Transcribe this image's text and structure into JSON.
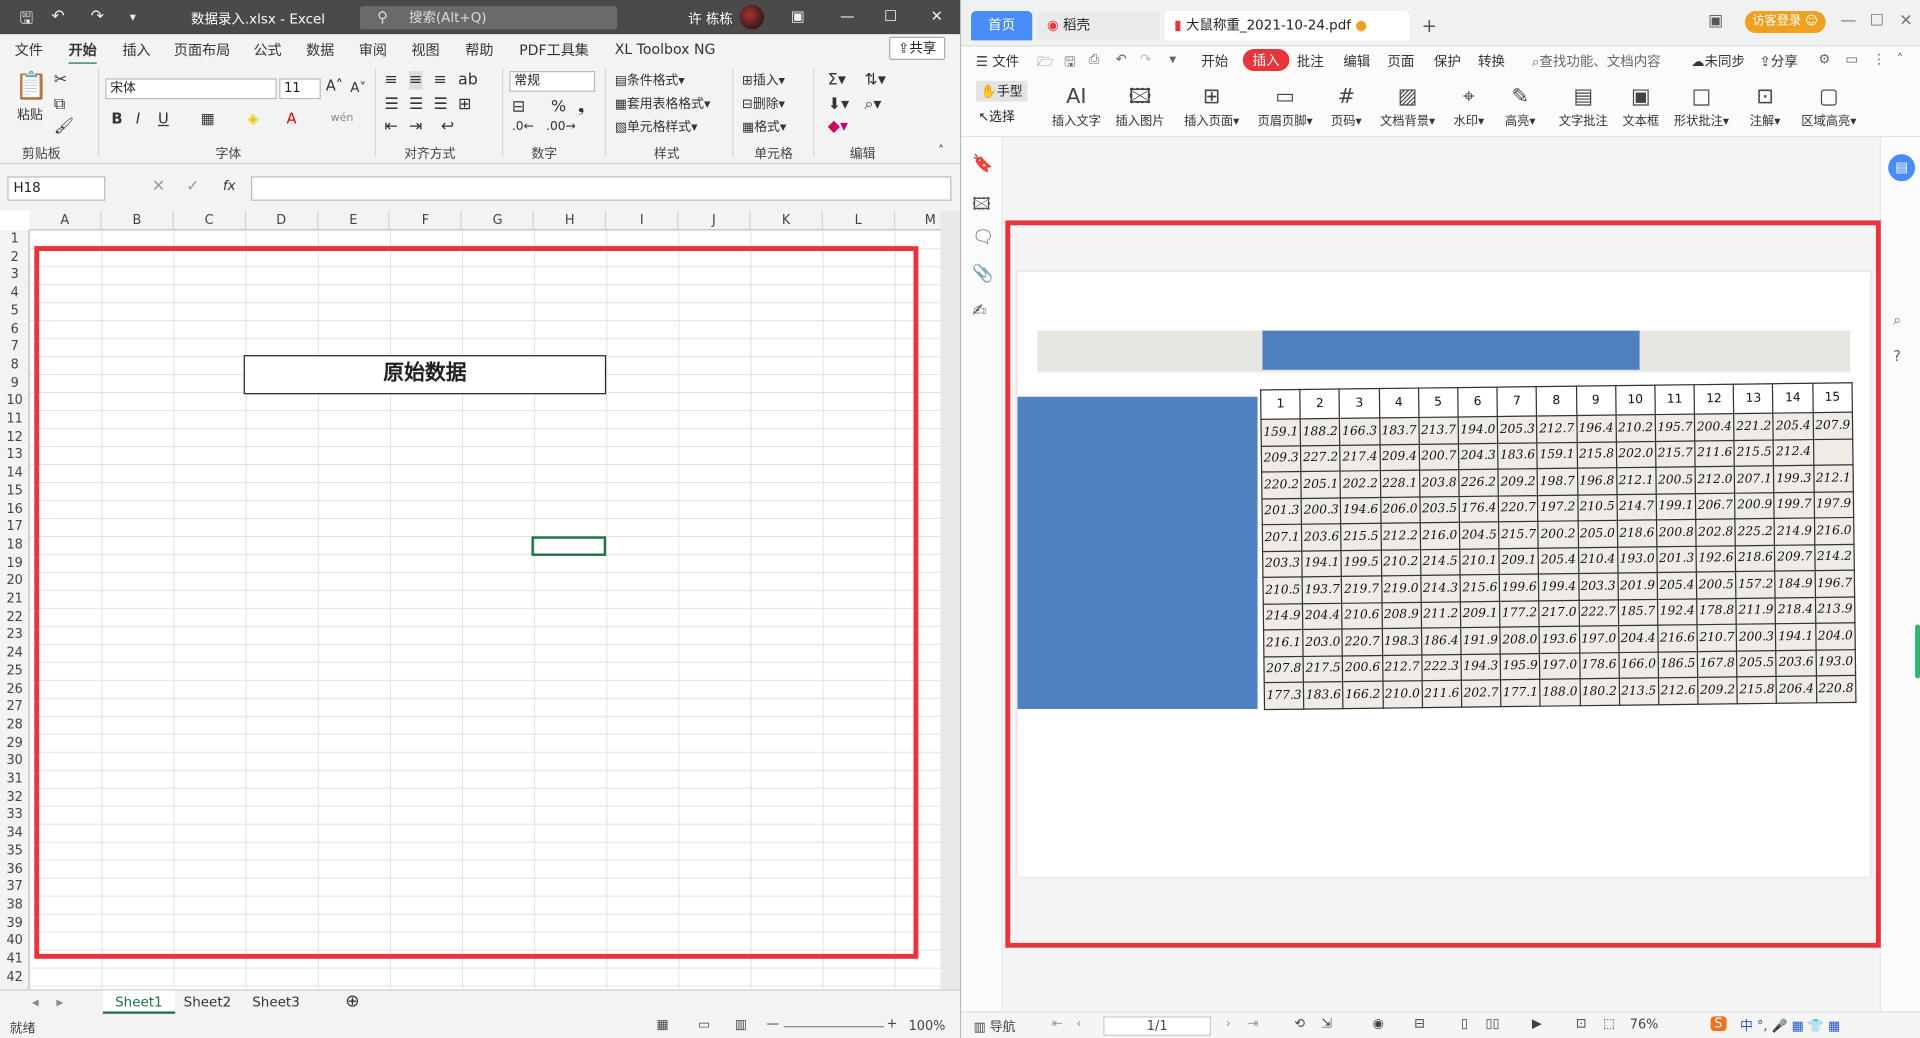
{
  "excel": {
    "title": {
      "filename": "数据录入.xlsx",
      "sep": " - ",
      "app": "Excel",
      "search": "搜索(Alt+Q)",
      "user": "许 栋栋"
    },
    "menu": [
      "文件",
      "开始",
      "插入",
      "页面布局",
      "公式",
      "数据",
      "审阅",
      "视图",
      "帮助",
      "PDF工具集",
      "XL Toolbox NG"
    ],
    "share": "共享",
    "ribbon": {
      "paste": "粘贴",
      "font_name": "宋体",
      "font_size": "11",
      "number_format": "常规",
      "cond_format": "条件格式",
      "table_format": "套用表格格式",
      "cell_style": "单元格样式",
      "insert": "插入",
      "delete": "删除",
      "format": "格式",
      "groups": [
        "剪贴板",
        "字体",
        "对齐方式",
        "数字",
        "样式",
        "单元格",
        "编辑"
      ]
    },
    "name_box": "H18",
    "columns": [
      "A",
      "B",
      "C",
      "D",
      "E",
      "F",
      "G",
      "H",
      "I",
      "J",
      "K",
      "L",
      "M"
    ],
    "rows": [
      "1",
      "2",
      "3",
      "4",
      "5",
      "6",
      "7",
      "8",
      "9",
      "10",
      "11",
      "12",
      "13",
      "14",
      "15",
      "16",
      "17",
      "18",
      "19",
      "20",
      "21",
      "22",
      "23",
      "24",
      "25",
      "26",
      "27",
      "28",
      "29",
      "30",
      "31",
      "32",
      "33",
      "34",
      "35",
      "36",
      "37",
      "38",
      "39",
      "40",
      "41",
      "42"
    ],
    "cell_title": "原始数据",
    "sheets": [
      "Sheet1",
      "Sheet2",
      "Sheet3"
    ],
    "status": "就绪",
    "zoom": "100%"
  },
  "wps": {
    "tabs": {
      "home": "首页",
      "daoke": "稻壳",
      "pdf": "大鼠称重_2021-10-24.pdf",
      "visitor": "访客登录"
    },
    "menu": [
      "文件",
      "开始",
      "插入",
      "批注",
      "编辑",
      "页面",
      "保护",
      "转换"
    ],
    "search": "查找功能、文档内容",
    "sync": "未同步",
    "share": "分享",
    "tools": [
      "手型",
      "选择",
      "插入文字",
      "插入图片",
      "插入页面",
      "页眉页脚",
      "页码",
      "文档背景",
      "水印",
      "高亮",
      "文字批注",
      "文本框",
      "形状批注",
      "注解",
      "区域高亮"
    ],
    "table": {
      "headers": [
        "1",
        "2",
        "3",
        "4",
        "5",
        "6",
        "7",
        "8",
        "9",
        "10",
        "11",
        "12",
        "13",
        "14",
        "15"
      ],
      "rows": [
        [
          "159.1",
          "188.2",
          "166.3",
          "183.7",
          "213.7",
          "194.0",
          "205.3",
          "212.7",
          "196.4",
          "210.2",
          "195.7",
          "200.4",
          "221.2",
          "205.4",
          "207.9"
        ],
        [
          "209.3",
          "227.2",
          "217.4",
          "209.4",
          "200.7",
          "204.3",
          "183.6",
          "159.1",
          "215.8",
          "202.0",
          "215.7",
          "211.6",
          "215.5",
          "212.4",
          ""
        ],
        [
          "220.2",
          "205.1",
          "202.2",
          "228.1",
          "203.8",
          "226.2",
          "209.2",
          "198.7",
          "196.8",
          "212.1",
          "200.5",
          "212.0",
          "207.1",
          "199.3",
          "212.1"
        ],
        [
          "201.3",
          "200.3",
          "194.6",
          "206.0",
          "203.5",
          "176.4",
          "220.7",
          "197.2",
          "210.5",
          "214.7",
          "199.1",
          "206.7",
          "200.9",
          "199.7",
          "197.9"
        ],
        [
          "207.1",
          "203.6",
          "215.5",
          "212.2",
          "216.0",
          "204.5",
          "215.7",
          "200.2",
          "205.0",
          "218.6",
          "200.8",
          "202.8",
          "225.2",
          "214.9",
          "216.0"
        ],
        [
          "203.3",
          "194.1",
          "199.5",
          "210.2",
          "214.5",
          "210.1",
          "209.1",
          "205.4",
          "210.4",
          "193.0",
          "201.3",
          "192.6",
          "218.6",
          "209.7",
          "214.2"
        ],
        [
          "210.5",
          "193.7",
          "219.7",
          "219.0",
          "214.3",
          "215.6",
          "199.6",
          "199.4",
          "203.3",
          "201.9",
          "205.4",
          "200.5",
          "157.2",
          "184.9",
          "196.7"
        ],
        [
          "214.9",
          "204.4",
          "210.6",
          "208.9",
          "211.2",
          "209.1",
          "177.2",
          "217.0",
          "222.7",
          "185.7",
          "192.4",
          "178.8",
          "211.9",
          "218.4",
          "213.9"
        ],
        [
          "216.1",
          "203.0",
          "220.7",
          "198.3",
          "186.4",
          "191.9",
          "208.0",
          "193.6",
          "197.0",
          "204.4",
          "216.6",
          "210.7",
          "200.3",
          "194.1",
          "204.0"
        ],
        [
          "207.8",
          "217.5",
          "200.6",
          "212.7",
          "222.3",
          "194.3",
          "195.9",
          "197.0",
          "178.6",
          "166.0",
          "186.5",
          "167.8",
          "205.5",
          "203.6",
          "193.0"
        ],
        [
          "177.3",
          "183.6",
          "166.2",
          "210.0",
          "211.6",
          "202.7",
          "177.1",
          "188.0",
          "180.2",
          "213.5",
          "212.6",
          "209.2",
          "215.8",
          "206.4",
          "220.8"
        ]
      ]
    },
    "nav": "导航",
    "page": "1/1",
    "zoom": "76%"
  }
}
